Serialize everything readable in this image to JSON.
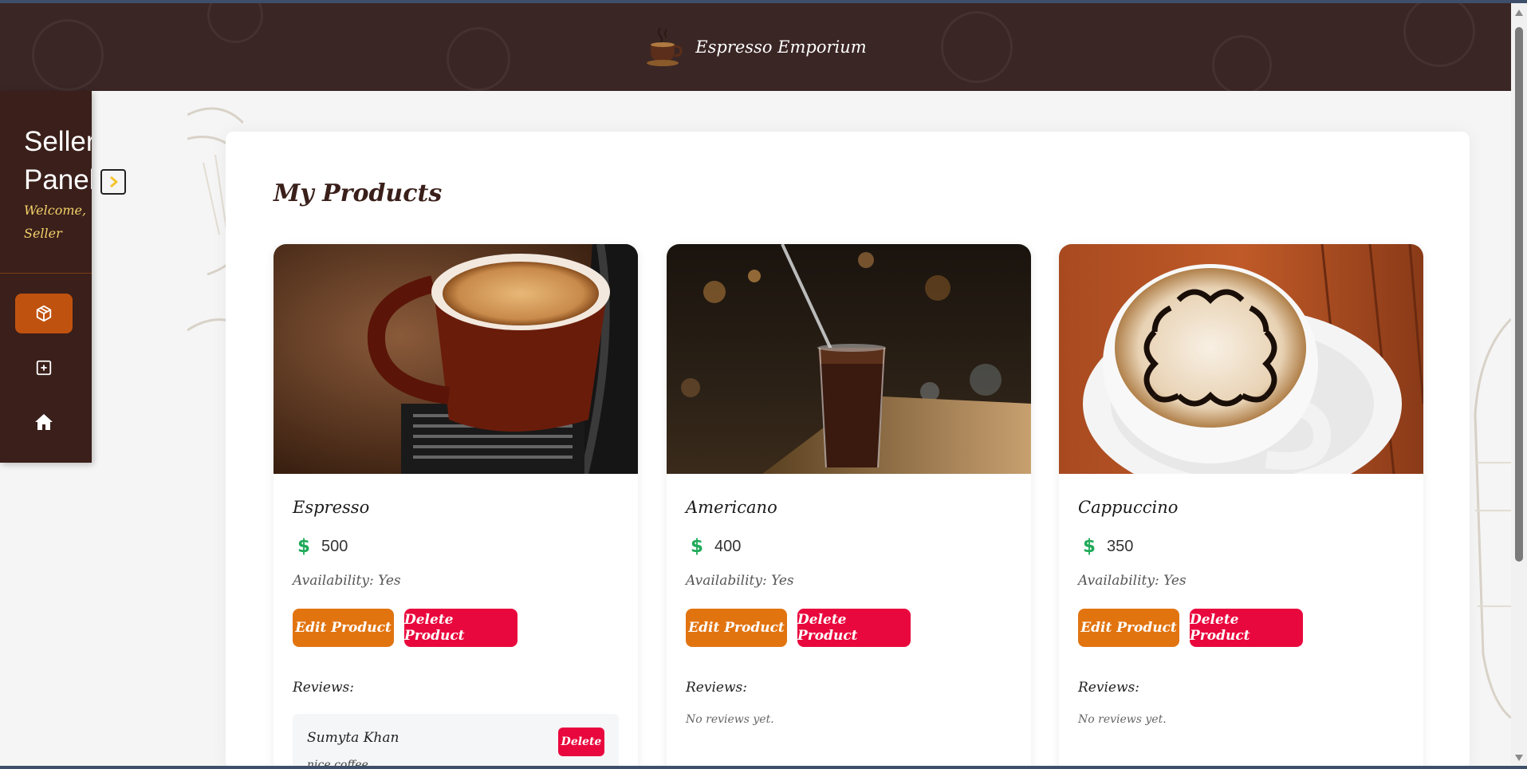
{
  "brand": {
    "name": "Espresso Emporium"
  },
  "sidebar": {
    "title": "Seller Panel",
    "welcome": "Welcome, Seller",
    "nav": [
      {
        "icon": "box-icon",
        "active": true
      },
      {
        "icon": "plus-square-icon",
        "active": false
      },
      {
        "icon": "home-icon",
        "active": false
      }
    ]
  },
  "main": {
    "title": "My Products",
    "products": [
      {
        "name": "Espresso",
        "price": "500",
        "availability": "Availability: Yes",
        "edit_label": "Edit Product",
        "delete_label": "Delete Product",
        "reviews_label": "Reviews:",
        "reviews": [
          {
            "author": "Sumyta Khan",
            "text": "nice coffee",
            "delete_label": "Delete"
          }
        ]
      },
      {
        "name": "Americano",
        "price": "400",
        "availability": "Availability: Yes",
        "edit_label": "Edit Product",
        "delete_label": "Delete Product",
        "reviews_label": "Reviews:",
        "no_reviews": "No reviews yet."
      },
      {
        "name": "Cappuccino",
        "price": "350",
        "availability": "Availability: Yes",
        "edit_label": "Edit Product",
        "delete_label": "Delete Product",
        "reviews_label": "Reviews:",
        "no_reviews": "No reviews yet."
      }
    ]
  },
  "colors": {
    "header_bg": "#3a2625",
    "sidebar_bg": "#3a1f1a",
    "accent_active": "#c0520f",
    "edit_button": "#e27410",
    "delete_button": "#e9083d",
    "price_icon": "#1faa59",
    "welcome_text": "#f4d26b"
  }
}
